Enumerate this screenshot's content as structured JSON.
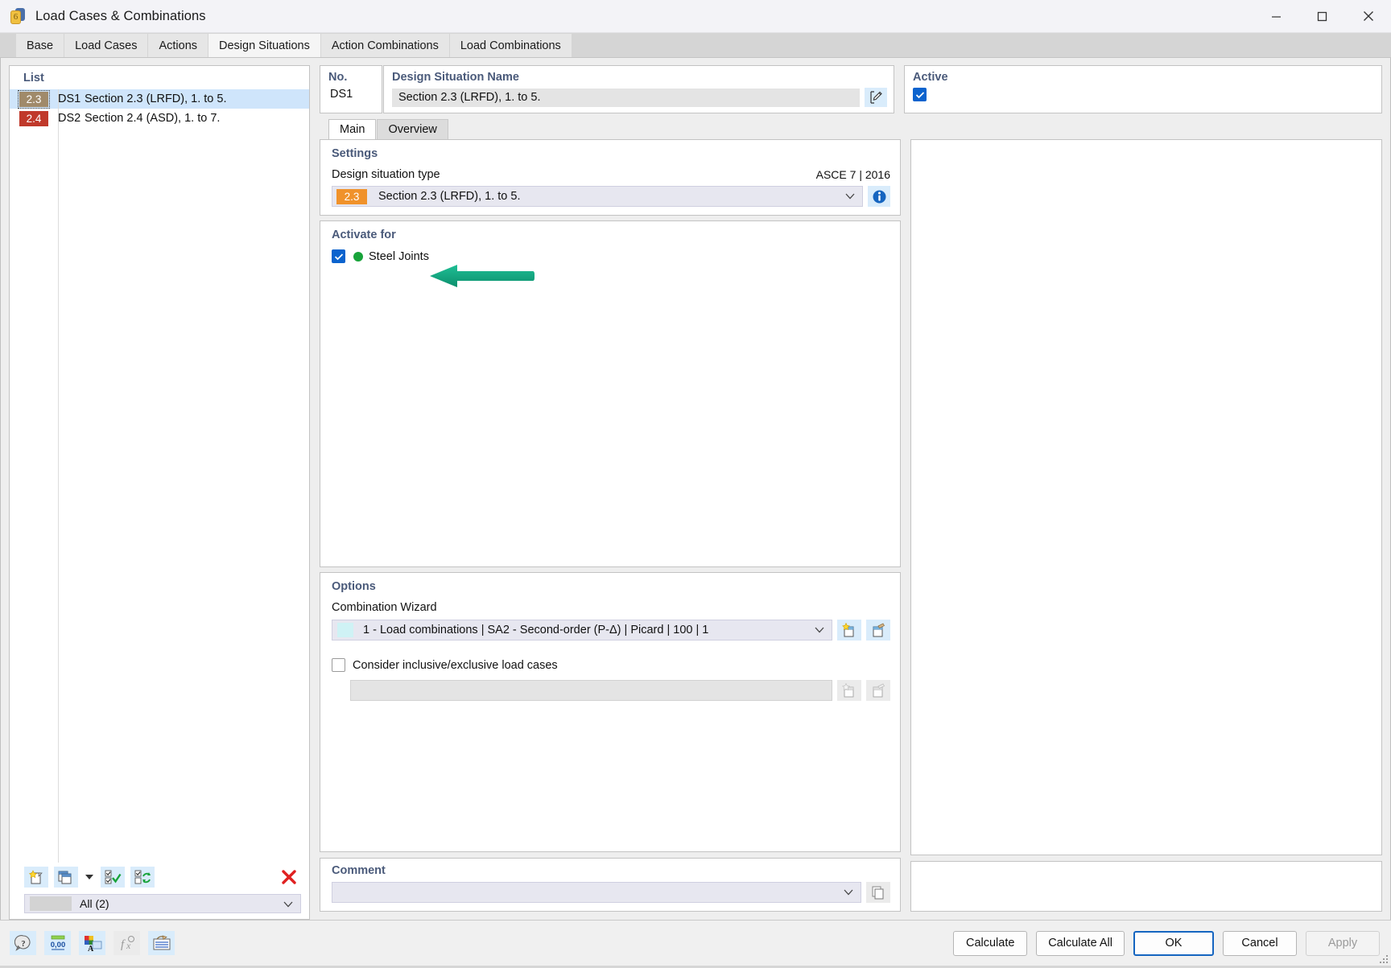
{
  "window": {
    "title": "Load Cases & Combinations",
    "icon": "load-case-icon",
    "controls": {
      "minimize": "minimize-icon",
      "maximize": "maximize-icon",
      "close": "close-icon"
    }
  },
  "tabs": [
    {
      "label": "Base",
      "active": false
    },
    {
      "label": "Load Cases",
      "active": false
    },
    {
      "label": "Actions",
      "active": false
    },
    {
      "label": "Design Situations",
      "active": true
    },
    {
      "label": "Action Combinations",
      "active": false
    },
    {
      "label": "Load Combinations",
      "active": false
    }
  ],
  "list": {
    "header": "List",
    "rows": [
      {
        "badge": "2.3",
        "badge_color": "#a08a6a",
        "no": "DS1",
        "name": "Section 2.3 (LRFD), 1. to 5.",
        "selected": true
      },
      {
        "badge": "2.4",
        "badge_color": "#c0392b",
        "no": "DS2",
        "name": "Section 2.4 (ASD), 1. to 7.",
        "selected": false
      }
    ],
    "toolbar": [
      {
        "name": "new-item-button",
        "icon": "new-page-icon"
      },
      {
        "name": "copy-item-button",
        "icon": "copy-pages-icon"
      },
      {
        "name": "copy-dropdown-button",
        "icon": "chevron-down-icon"
      },
      {
        "name": "select-all-button",
        "icon": "check-all-icon"
      },
      {
        "name": "invert-selection-button",
        "icon": "invert-check-icon"
      },
      {
        "name": "delete-item-button",
        "icon": "red-x-icon"
      }
    ],
    "filter": {
      "value": "All (2)",
      "caret": "chevron-down-icon"
    }
  },
  "header_fields": {
    "no": {
      "label": "No.",
      "value": "DS1"
    },
    "name": {
      "label": "Design Situation Name",
      "value": "Section 2.3 (LRFD), 1. to 5.",
      "edit_icon": "edit-pencil-icon"
    },
    "active": {
      "label": "Active",
      "checked": true
    }
  },
  "inner_tabs": [
    {
      "label": "Main",
      "active": true
    },
    {
      "label": "Overview",
      "active": false
    }
  ],
  "settings": {
    "title": "Settings",
    "field_label": "Design situation type",
    "standard": "ASCE 7 | 2016",
    "value_badge": "2.3",
    "value_badge_color": "#f0922b",
    "value": "Section 2.3 (LRFD), 1. to 5.",
    "caret": "chevron-down-icon",
    "info_icon": "info-icon"
  },
  "activate_for": {
    "title": "Activate for",
    "items": [
      {
        "label": "Steel Joints",
        "checked": true,
        "dot_color": "#18a33a"
      }
    ]
  },
  "options": {
    "title": "Options",
    "wizard_label": "Combination Wizard",
    "wizard_value": "1 - Load combinations | SA2 - Second-order (P-Δ) | Picard | 100 | 1",
    "wizard_caret": "chevron-down-icon",
    "wizard_new_icon": "new-wizard-icon",
    "wizard_edit_icon": "edit-wizard-icon",
    "inclusive_label": "Consider inclusive/exclusive load cases",
    "inclusive_checked": false,
    "inclusive_value": "",
    "inclusive_new_icon": "new-item-icon",
    "inclusive_edit_icon": "edit-item-icon"
  },
  "comment": {
    "title": "Comment",
    "value": "",
    "caret": "chevron-down-icon",
    "copy_icon": "copy-comment-icon"
  },
  "annotation": {
    "type": "green-left-arrow",
    "color": "#13a882"
  },
  "statusbar": {
    "icons": [
      {
        "name": "help-icon",
        "enabled": true
      },
      {
        "name": "units-icon",
        "enabled": true
      },
      {
        "name": "colors-icon",
        "enabled": true
      },
      {
        "name": "formula-icon",
        "enabled": false
      },
      {
        "name": "table-settings-icon",
        "enabled": true
      }
    ],
    "buttons": [
      {
        "label": "Calculate",
        "style": "normal"
      },
      {
        "label": "Calculate All",
        "style": "normal"
      },
      {
        "label": "OK",
        "style": "primary"
      },
      {
        "label": "Cancel",
        "style": "normal"
      },
      {
        "label": "Apply",
        "style": "disabled"
      }
    ]
  }
}
